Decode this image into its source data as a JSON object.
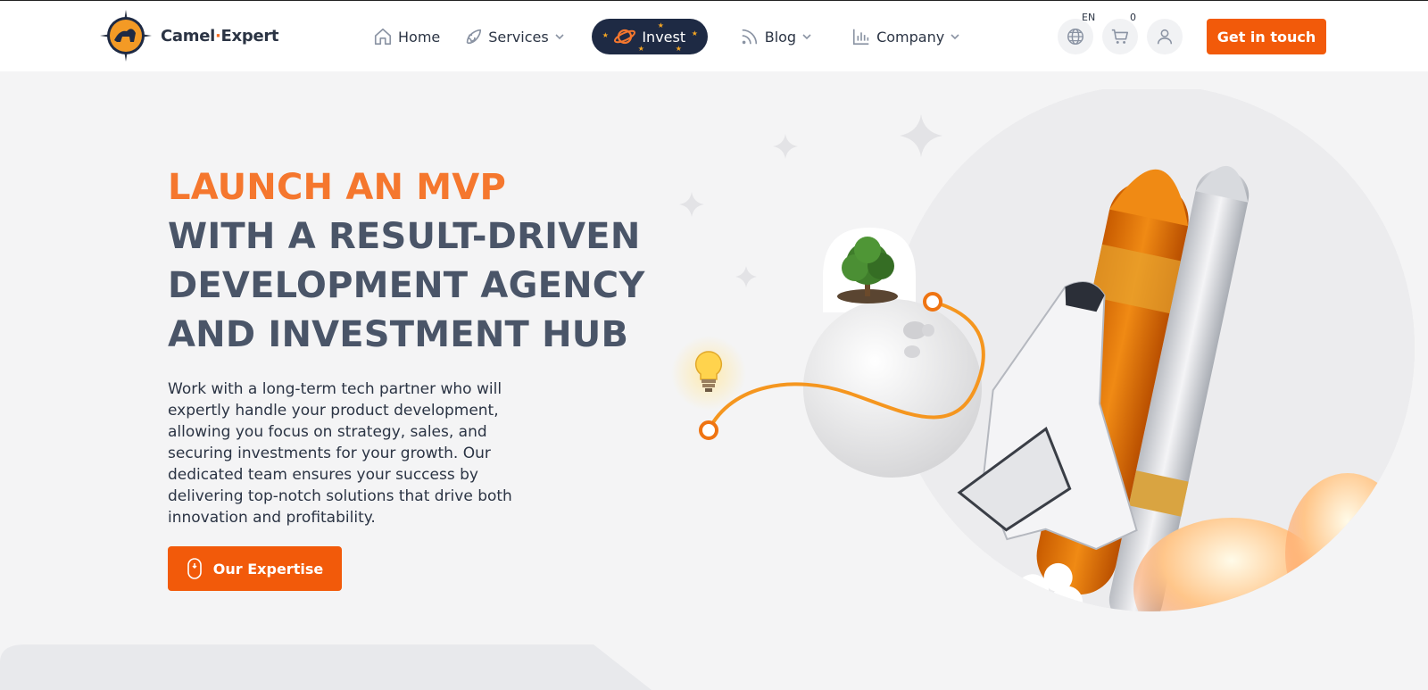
{
  "brand": {
    "name_part1": "Camel",
    "name_dot": "·",
    "name_part2": "Expert",
    "accent_color": "#f25a0a",
    "dark_color": "#1e2a44"
  },
  "nav": {
    "home": "Home",
    "services": "Services",
    "invest": "Invest",
    "blog": "Blog",
    "company": "Company"
  },
  "utilities": {
    "language": "EN",
    "cart_count": "0",
    "cta": "Get in touch"
  },
  "hero": {
    "title_accent": "LAUNCH AN MVP",
    "title_line1": "WITH A RESULT-DRIVEN",
    "title_line2": "DEVELOPMENT AGENCY",
    "title_line3": "AND INVESTMENT HUB",
    "description": "Work with a long-term tech partner who will expertly handle your product development, allowing you focus on strategy, sales, and securing investments for your growth. Our dedicated team ensures your success by delivering top-notch solutions that drive both innovation and profitability.",
    "cta": "Our Expertise"
  },
  "icons": [
    "home-icon",
    "rocket-icon",
    "planet-icon",
    "rss-icon",
    "bar-chart-icon",
    "globe-icon",
    "cart-icon",
    "user-icon",
    "mouse-icon",
    "chevron-down-icon"
  ]
}
